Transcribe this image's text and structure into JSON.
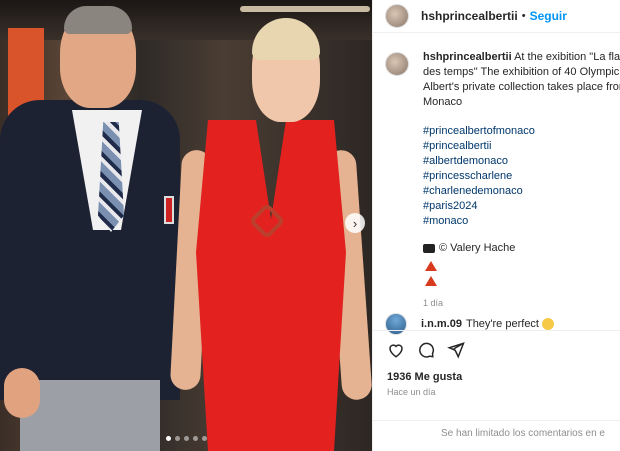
{
  "post": {
    "username": "hshprincealbertii",
    "separator": "•",
    "follow_label": "Seguir"
  },
  "caption": {
    "username": "hshprincealbertii",
    "line1": "At the exibition \"La flam",
    "line2": "des temps\" The exhibition of 40 Olympic",
    "line3": "Albert's private collection takes place from",
    "line4": "Monaco",
    "hashtags": [
      "#princealbertofmonaco",
      "#princealbertii",
      "#albertdemonaco",
      "#princesscharlene",
      "#charlenedemonaco",
      "#paris2024",
      "#monaco"
    ],
    "credit": "© Valery Hache",
    "time": "1 día"
  },
  "comment": {
    "username": "i.n.m.09",
    "text": "They're perfect"
  },
  "likes": "1936 Me gusta",
  "posted": "Hace un día",
  "comments_limited": "Se han limitado los comentarios en e",
  "media": {
    "carousel_dots": 5,
    "active_dot": 0,
    "next_arrow": "›"
  },
  "icons": {
    "like": "heart-icon",
    "comment": "comment-icon",
    "share": "share-icon",
    "camera": "camera-icon",
    "warning": "red-triangle-icon",
    "emoji": "smiley-emoji-icon"
  },
  "colors": {
    "follow": "#0095f6",
    "hashtag": "#00376b",
    "meta": "#8e8e8e",
    "dress": "#e3211f"
  }
}
